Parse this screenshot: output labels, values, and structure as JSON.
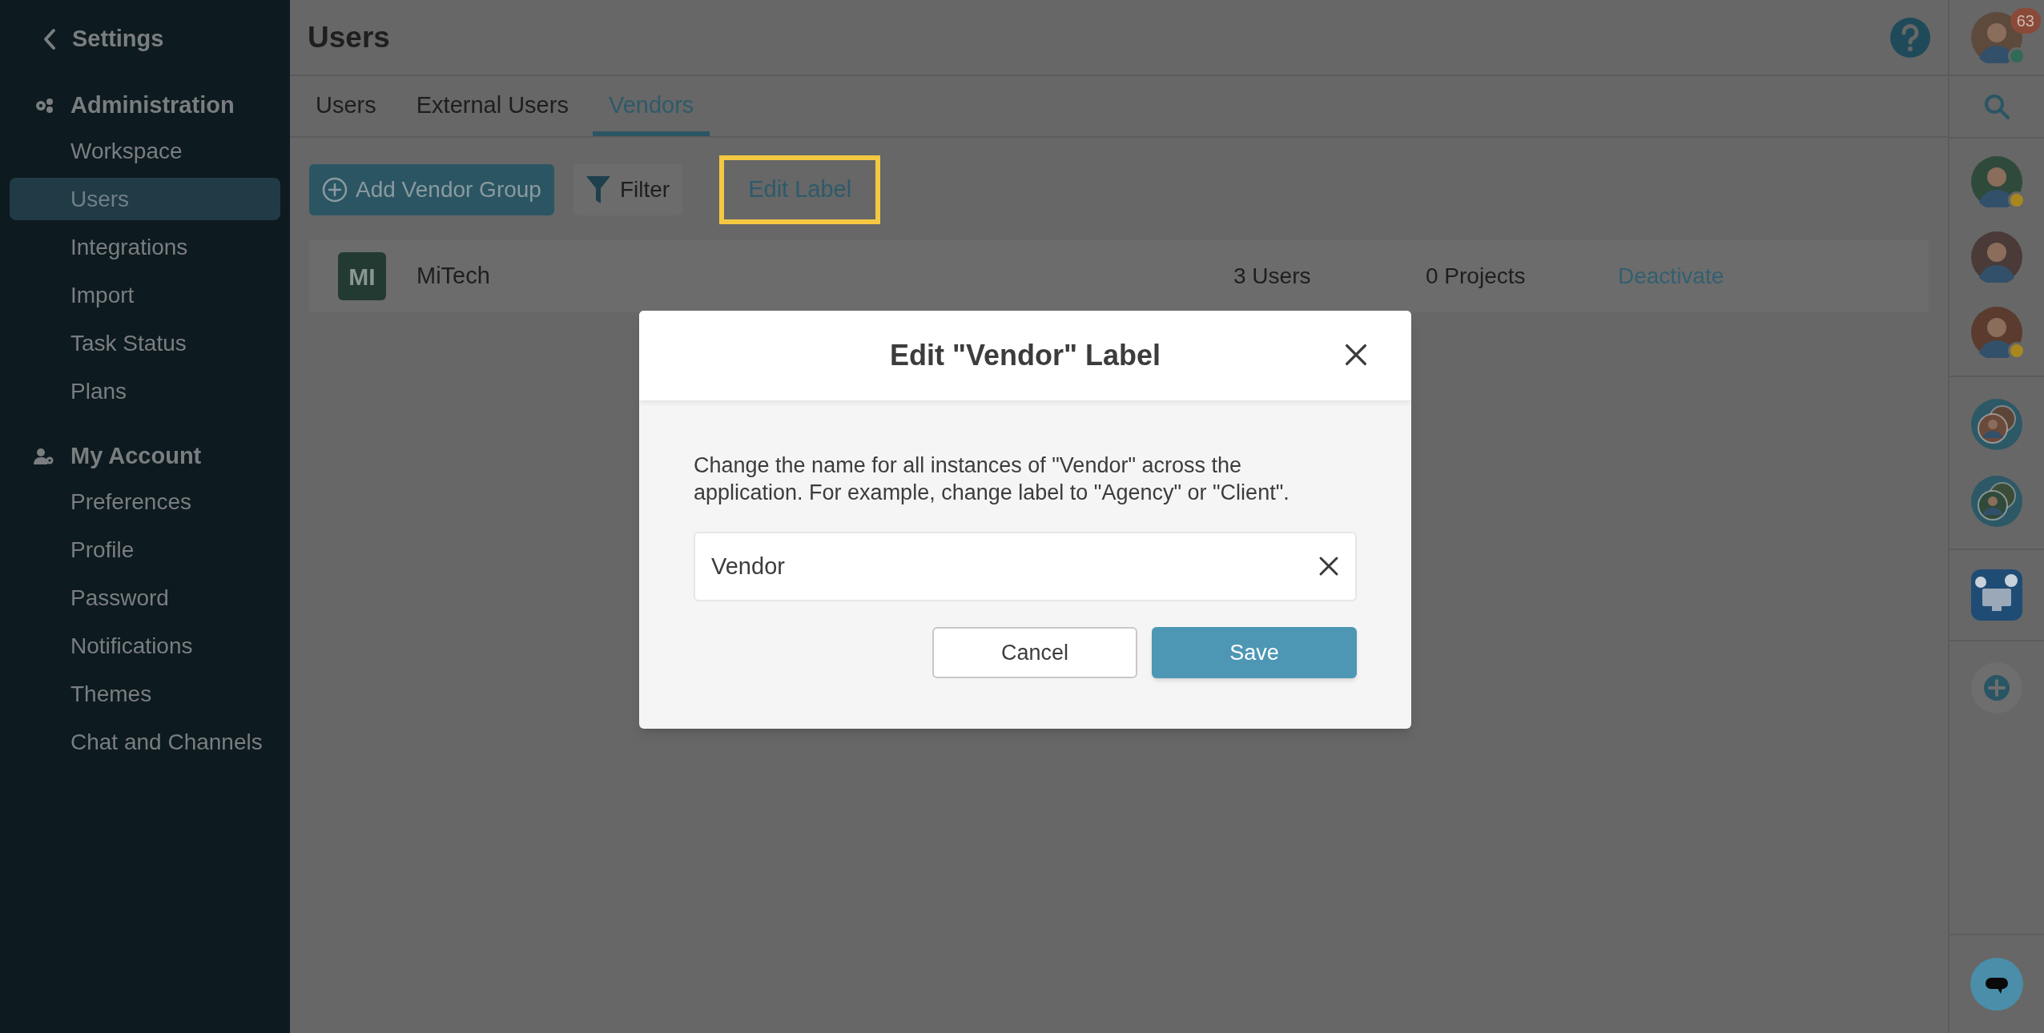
{
  "sidebar": {
    "back_label": "Settings",
    "sections": [
      {
        "title": "Administration",
        "items": [
          {
            "label": "Workspace",
            "selected": false
          },
          {
            "label": "Users",
            "selected": true
          },
          {
            "label": "Integrations",
            "selected": false
          },
          {
            "label": "Import",
            "selected": false
          },
          {
            "label": "Task Status",
            "selected": false
          },
          {
            "label": "Plans",
            "selected": false
          }
        ]
      },
      {
        "title": "My Account",
        "items": [
          {
            "label": "Preferences",
            "selected": false
          },
          {
            "label": "Profile",
            "selected": false
          },
          {
            "label": "Password",
            "selected": false
          },
          {
            "label": "Notifications",
            "selected": false
          },
          {
            "label": "Themes",
            "selected": false
          },
          {
            "label": "Chat and Channels",
            "selected": false
          }
        ]
      }
    ]
  },
  "header": {
    "title": "Users"
  },
  "tabs": [
    {
      "label": "Users",
      "selected": false
    },
    {
      "label": "External Users",
      "selected": false
    },
    {
      "label": "Vendors",
      "selected": true
    }
  ],
  "toolbar": {
    "add_button": "Add Vendor Group",
    "filter_button": "Filter",
    "edit_label_link": "Edit Label"
  },
  "vendors": [
    {
      "logo": "MI",
      "name": "MiTech",
      "users": "3 Users",
      "projects": "0 Projects",
      "action": "Deactivate"
    }
  ],
  "right_rail": {
    "badge": "63",
    "avatars": [
      {
        "has_status": true,
        "color": "#2f6b57"
      },
      {
        "has_status": true,
        "color": "#a8871f"
      },
      {
        "has_status": false
      },
      {
        "has_status": true,
        "color": "#a8871f"
      }
    ]
  },
  "dialog": {
    "title": "Edit \"Vendor\" Label",
    "description": "Change the name for all instances of \"Vendor\" across the application. For example, change label to \"Agency\" or \"Client\".",
    "input_value": "Vendor",
    "cancel": "Cancel",
    "save": "Save"
  }
}
